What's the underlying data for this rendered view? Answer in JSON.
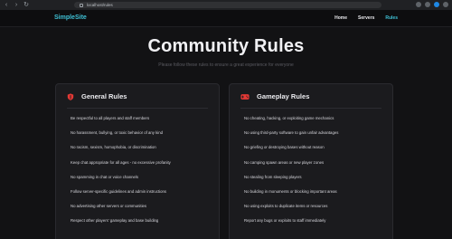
{
  "browser": {
    "url": "localhost/rules"
  },
  "site": {
    "logo": "SimpleSite",
    "nav": [
      {
        "label": "Home",
        "active": false
      },
      {
        "label": "Servers",
        "active": false
      },
      {
        "label": "Rules",
        "active": true
      }
    ]
  },
  "hero": {
    "title": "Community Rules",
    "subtitle": "Please follow these rules to ensure a great experience for everyone"
  },
  "cards": [
    {
      "title": "General Rules",
      "icon": "shield-icon",
      "icon_color": "#e53935",
      "rules": [
        "Be respectful to all players and staff members",
        "No harassment, bullying, or toxic behavior of any kind",
        "No racism, sexism, homophobia, or discrimination",
        "Keep chat appropriate for all ages - no excessive profanity",
        "No spamming in chat or voice channels",
        "Follow server-specific guidelines and admin instructions",
        "No advertising other servers or communities",
        "Respect other players' gameplay and base building"
      ]
    },
    {
      "title": "Gameplay Rules",
      "icon": "gamepad-icon",
      "icon_color": "#e53935",
      "rules": [
        "No cheating, hacking, or exploiting game mechanics",
        "No using third-party software to gain unfair advantages",
        "No griefing or destroying bases without reason",
        "No camping spawn areas or new player zones",
        "No stealing from sleeping players",
        "No building in monuments or blocking important areas",
        "No using exploits to duplicate items or resources",
        "Report any bugs or exploits to staff immediately"
      ]
    }
  ],
  "colors": {
    "background": "#121214",
    "card": "#1b1b1e",
    "accent": "#3fc1d6",
    "icon": "#e53935"
  }
}
